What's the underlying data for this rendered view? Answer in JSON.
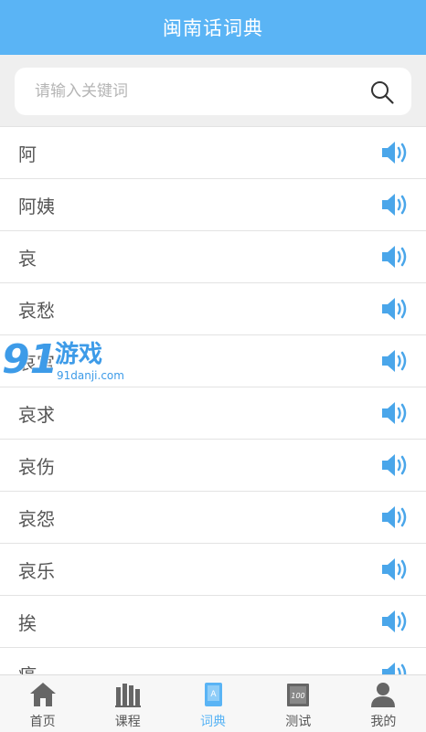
{
  "header": {
    "title": "闽南话词典"
  },
  "search": {
    "placeholder": "请输入关键词",
    "value": "",
    "icon": "search-icon"
  },
  "words": [
    {
      "label": "阿",
      "icon": "speaker-icon"
    },
    {
      "label": "阿姨",
      "icon": "speaker-icon"
    },
    {
      "label": "哀",
      "icon": "speaker-icon"
    },
    {
      "label": "哀愁",
      "icon": "speaker-icon"
    },
    {
      "label": "哀宫",
      "icon": "speaker-icon"
    },
    {
      "label": "哀求",
      "icon": "speaker-icon"
    },
    {
      "label": "哀伤",
      "icon": "speaker-icon"
    },
    {
      "label": "哀怨",
      "icon": "speaker-icon"
    },
    {
      "label": "哀乐",
      "icon": "speaker-icon"
    },
    {
      "label": "挨",
      "icon": "speaker-icon"
    },
    {
      "label": "癌",
      "icon": "speaker-icon"
    }
  ],
  "tabs": [
    {
      "label": "首页",
      "icon": "home-icon",
      "active": false
    },
    {
      "label": "课程",
      "icon": "books-icon",
      "active": false
    },
    {
      "label": "词典",
      "icon": "dictionary-icon",
      "active": true
    },
    {
      "label": "测试",
      "icon": "test-icon",
      "active": false
    },
    {
      "label": "我的",
      "icon": "user-icon",
      "active": false
    }
  ],
  "watermark": {
    "number": "91",
    "name": "游戏",
    "url": "91danji.com"
  },
  "colors": {
    "accent": "#5ab4f5",
    "speaker": "#4aa6ea",
    "tab_inactive": "#555555"
  }
}
